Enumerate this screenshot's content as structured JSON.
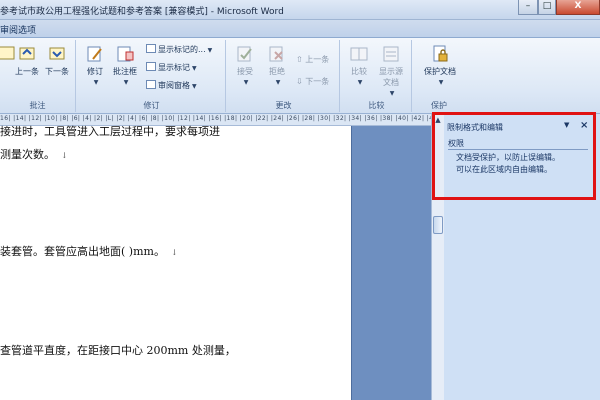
{
  "window": {
    "title": "参考试市政公用工程强化试题和参考答案 [兼容模式] - Microsoft Word",
    "controls": {
      "minimize": "–",
      "maximize": "□",
      "close": "X"
    }
  },
  "ribbon": {
    "active_tab": "审阅选项",
    "help": "?",
    "comments_group": {
      "label": "批注",
      "buttons": [
        "上一条",
        "下一条"
      ]
    },
    "tracking_group": {
      "label": "修订",
      "track_changes": "修订",
      "balloons": "批注框",
      "display_for_review": "显示标记的...",
      "show_markup": "显示标记",
      "reviewing_pane": "审阅窗格"
    },
    "changes_group": {
      "label": "更改",
      "accept": "接受",
      "reject": "拒绝",
      "previous": "上一条",
      "next": "下一条"
    },
    "compare_group": {
      "label": "比较",
      "compare": "比较",
      "show_source": "显示源文档"
    },
    "protect_group": {
      "label": "保护",
      "protect_document": "保护文档"
    }
  },
  "ruler": {
    "numbers": "16| |14| |12| |10| |8| |6| |4| |2| |L| |2| |4| |6| |8| |10| |12| |14| |16| |18| |20| |22| |24| |26| |28| |30| |32| |34| |36| |38| |40| |42| |44| |46| |48"
  },
  "document": {
    "lines": [
      "接进时，工具管进入工层过程中，要求每项进",
      "测量次数。",
      "装套管。套管应高出地面(  )mm。",
      "查管道平直度，在距接口中心 200mm 处测量，"
    ],
    "paragraph_mark": "↓"
  },
  "task_pane": {
    "title": "限制格式和编辑",
    "menu": "▼",
    "close": "×",
    "section": "权限",
    "messages": [
      "文档受保护，以防止误编辑。",
      "可以在此区域内自由编辑。"
    ]
  },
  "highlight_color": "#e01313"
}
